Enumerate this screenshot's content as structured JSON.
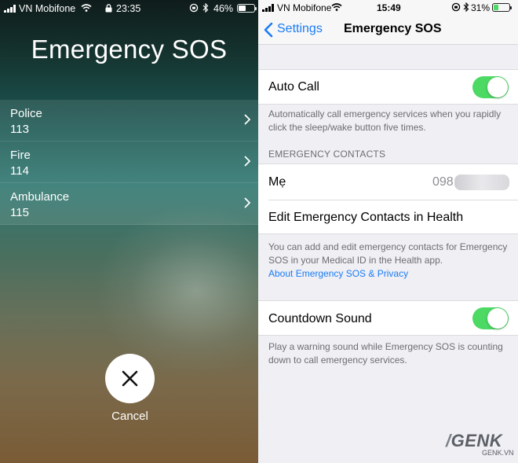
{
  "left": {
    "status": {
      "carrier": "VN Mobifone",
      "time": "23:35",
      "battery": "46%",
      "battery_level": 0.46
    },
    "title": "Emergency SOS",
    "services": [
      {
        "name": "Police",
        "number": "113"
      },
      {
        "name": "Fire",
        "number": "114"
      },
      {
        "name": "Ambulance",
        "number": "115"
      }
    ],
    "cancel_label": "Cancel"
  },
  "right": {
    "status": {
      "carrier": "VN Mobifone",
      "time": "15:49",
      "battery": "31%",
      "battery_level": 0.31
    },
    "nav": {
      "back_label": "Settings",
      "title": "Emergency SOS"
    },
    "auto_call": {
      "label": "Auto Call",
      "enabled": true,
      "description": "Automatically call emergency services when you rapidly click the sleep/wake button five times."
    },
    "emergency_contacts": {
      "header": "EMERGENCY CONTACTS",
      "contact_name": "Mẹ",
      "contact_number": "098",
      "edit_link": "Edit Emergency Contacts in Health",
      "description": "You can add and edit emergency contacts for Emergency SOS in your Medical ID in the Health app.",
      "about_link": "About Emergency SOS & Privacy"
    },
    "countdown_sound": {
      "label": "Countdown Sound",
      "enabled": true,
      "description": "Play a warning sound while Emergency SOS is counting down to call emergency services."
    },
    "watermark": {
      "logo": "GENK",
      "site": "GENK.VN"
    }
  },
  "colors": {
    "accent_blue": "#1a7cf5",
    "toggle_green": "#4cd964",
    "battery_green": "#4cd964",
    "background": "#efeff4"
  }
}
